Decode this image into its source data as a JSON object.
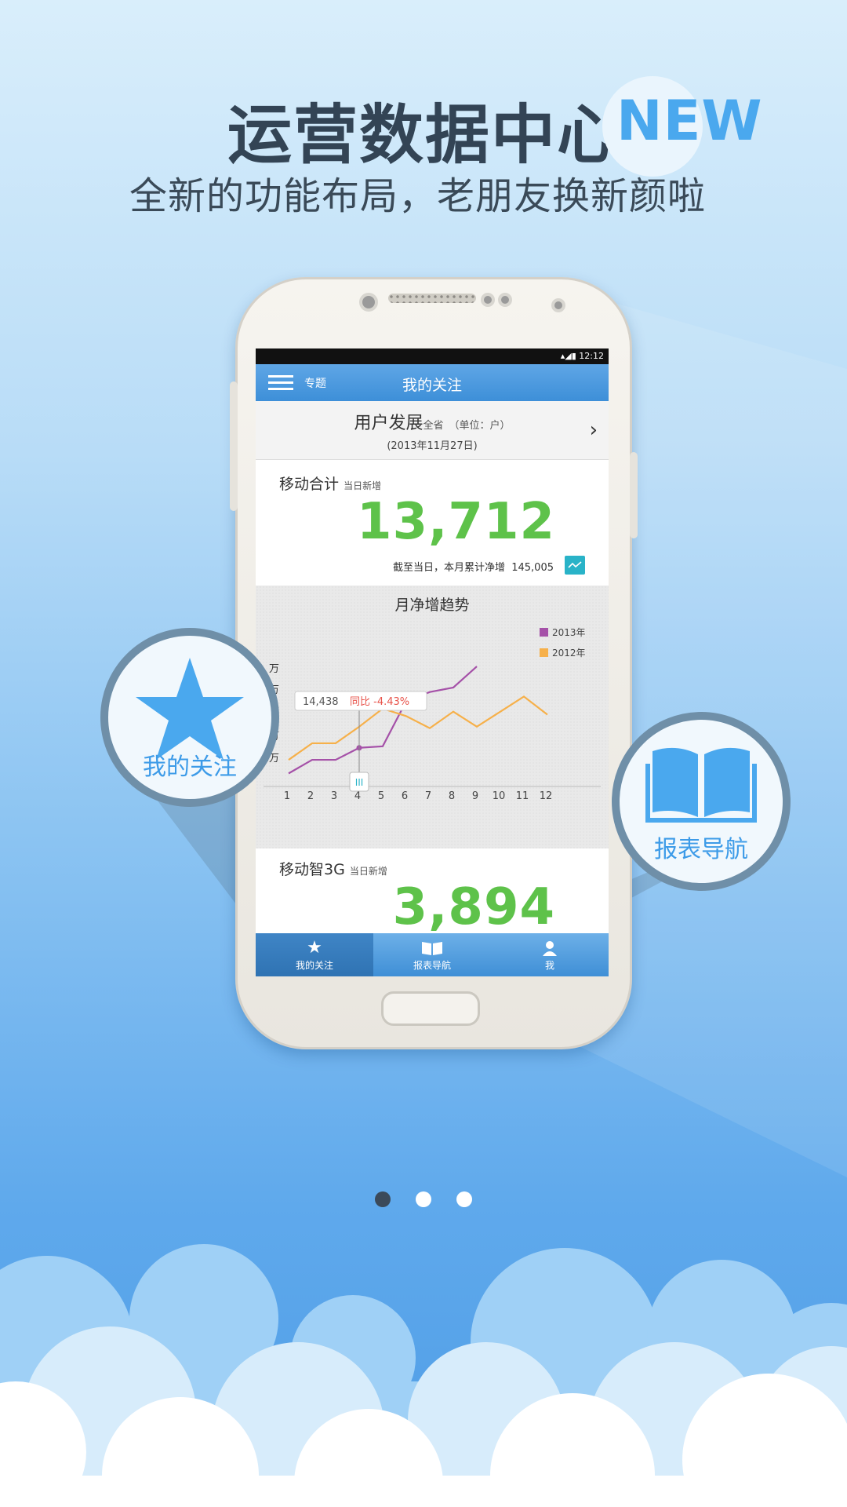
{
  "hero": {
    "title": "运营数据中心",
    "badge": "NEW",
    "subtitle": "全新的功能布局，老朋友换新颜啦"
  },
  "phone": {
    "status_bar": {
      "time": "12:12"
    },
    "app_bar": {
      "menu_label": "专题",
      "title": "我的关注"
    },
    "section": {
      "title": "用户发展",
      "scope": "全省",
      "unit": "（单位：户）",
      "date": "(2013年11月27日)"
    },
    "card1": {
      "label": "移动合计",
      "sublabel": "当日新增",
      "value": "13,712",
      "cumulative_label": "截至当日，本月累计净增",
      "cumulative_value": "145,005"
    },
    "card2": {
      "label": "移动智3G",
      "sublabel": "当日新增",
      "value": "3,894"
    },
    "tabs": [
      {
        "label": "我的关注",
        "icon": "star-icon",
        "active": true
      },
      {
        "label": "报表导航",
        "icon": "book-icon",
        "active": false
      },
      {
        "label": "我",
        "icon": "user-icon",
        "active": false
      }
    ]
  },
  "callouts": {
    "left": {
      "label": "我的关注",
      "icon": "star-icon"
    },
    "right": {
      "label": "报表导航",
      "icon": "book-icon"
    }
  },
  "pager": {
    "count": 3,
    "active_index": 0
  },
  "colors": {
    "accent": "#3d9be8",
    "number_green": "#5ec24a",
    "series_2013": "#a551a8",
    "series_2012": "#f6b04a"
  },
  "chart_data": {
    "type": "line",
    "title": "月净增趋势",
    "x": [
      1,
      2,
      3,
      4,
      5,
      6,
      7,
      8,
      9,
      10,
      11,
      12
    ],
    "xlabel": "",
    "ylabel": "",
    "y_tick_labels": [
      "2万",
      "4万",
      "万",
      "万",
      "万"
    ],
    "series": [
      {
        "name": "2013年",
        "color": "#a551a8",
        "values": [
          1.7,
          2.6,
          2.6,
          3.4,
          3.5,
          6.5,
          7.1,
          7.4,
          8.8
        ]
      },
      {
        "name": "2012年",
        "color": "#f6b04a",
        "values": [
          2.6,
          3.7,
          3.7,
          4.8,
          6.0,
          5.5,
          4.7,
          5.8,
          4.8,
          5.8,
          6.8,
          5.6
        ]
      }
    ],
    "tooltip": {
      "value": "14,438",
      "compare": "同比 -4.43%",
      "x": 4
    },
    "legend": "top-right",
    "ylim": [
      0,
      10
    ]
  }
}
